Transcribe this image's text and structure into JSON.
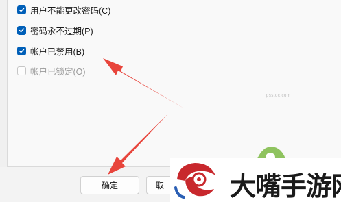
{
  "options": [
    {
      "label": "用户不能更改密码(C)",
      "checked": true,
      "disabled": false
    },
    {
      "label": "密码永不过期(P)",
      "checked": true,
      "disabled": false
    },
    {
      "label": "帐户已禁用(B)",
      "checked": true,
      "disabled": false
    },
    {
      "label": "帐户已锁定(O)",
      "checked": false,
      "disabled": true
    }
  ],
  "buttons": {
    "ok_label": "确定",
    "cancel_label": "取"
  },
  "watermark": {
    "site_text": "psstoc.com",
    "brand_text": "大嘴手游网"
  },
  "colors": {
    "accent": "#005fb8",
    "arrow": "#e8453c",
    "logo_red": "#c8282d"
  }
}
